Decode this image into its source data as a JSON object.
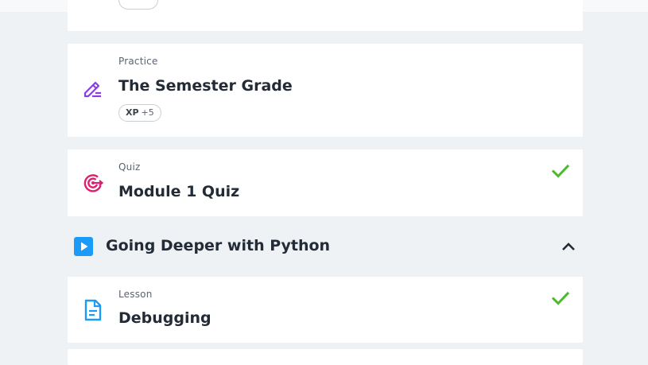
{
  "colors": {
    "page_bg": "#eef2f5",
    "card_bg": "#ffffff",
    "practice_icon": "#8a3ee0",
    "quiz_icon": "#e01e6f",
    "lesson_icon": "#1b9af7",
    "check": "#4cba2e",
    "section_icon": "#1b9af7"
  },
  "items": [
    {
      "type": "Practice",
      "title": "The Semester Grade",
      "icon": "pencil-lines-icon",
      "xp_label": "XP",
      "xp_value": "+5",
      "completed": false
    },
    {
      "type": "Quiz",
      "title": "Module 1 Quiz",
      "icon": "target-icon",
      "completed": true
    },
    {
      "type": "Lesson",
      "title": "Debugging",
      "icon": "document-icon",
      "completed": true
    }
  ],
  "section": {
    "title": "Going Deeper with Python",
    "icon": "play-icon",
    "expanded": true
  }
}
